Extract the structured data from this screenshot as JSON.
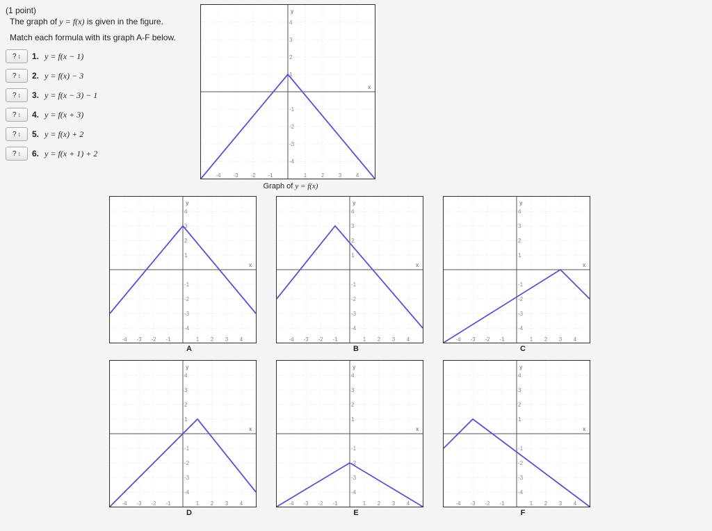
{
  "points_label": "(1 point)",
  "stem_pre": "The graph of ",
  "stem_eq": "y = f(x)",
  "stem_post": " is given in the figure.",
  "match_instr": "Match each formula with its graph A-F below.",
  "selector_placeholder": "?",
  "questions": [
    {
      "num": "1.",
      "text": "y = f(x − 1)"
    },
    {
      "num": "2.",
      "text": "y = f(x) − 3"
    },
    {
      "num": "3.",
      "text": "y = f(x − 3) − 1"
    },
    {
      "num": "4.",
      "text": "y = f(x + 3)"
    },
    {
      "num": "5.",
      "text": "y = f(x) + 2"
    },
    {
      "num": "6.",
      "text": "y = f(x + 1) + 2"
    }
  ],
  "main_caption_pre": "Graph of ",
  "main_caption_eq": "y = f(x)",
  "graph_labels": [
    "A",
    "B",
    "C",
    "D",
    "E",
    "F"
  ],
  "chart_data": [
    {
      "type": "line",
      "name": "main",
      "xlabel": "x",
      "ylabel": "y",
      "xlim": [
        -5,
        5
      ],
      "ylim": [
        -5,
        5
      ],
      "series": [
        {
          "name": "f(x)",
          "points": [
            [
              -5,
              -5
            ],
            [
              0,
              1
            ],
            [
              5,
              -5
            ]
          ]
        }
      ]
    },
    {
      "type": "line",
      "name": "A",
      "xlabel": "x",
      "ylabel": "y",
      "xlim": [
        -5,
        5
      ],
      "ylim": [
        -5,
        5
      ],
      "series": [
        {
          "name": "f(x)+2",
          "points": [
            [
              -5,
              -3
            ],
            [
              0,
              3
            ],
            [
              5,
              -3
            ]
          ]
        }
      ]
    },
    {
      "type": "line",
      "name": "B",
      "xlabel": "x",
      "ylabel": "y",
      "xlim": [
        -5,
        5
      ],
      "ylim": [
        -5,
        5
      ],
      "series": [
        {
          "name": "f(x+1)+2",
          "points": [
            [
              -5,
              -2
            ],
            [
              -1,
              3
            ],
            [
              5,
              -4
            ]
          ]
        }
      ]
    },
    {
      "type": "line",
      "name": "C",
      "xlabel": "x",
      "ylabel": "y",
      "xlim": [
        -5,
        5
      ],
      "ylim": [
        -5,
        5
      ],
      "series": [
        {
          "name": "f(x-3)-1",
          "points": [
            [
              -5,
              -5
            ],
            [
              3,
              0
            ],
            [
              5,
              -2
            ]
          ]
        }
      ]
    },
    {
      "type": "line",
      "name": "D",
      "xlabel": "x",
      "ylabel": "y",
      "xlim": [
        -5,
        5
      ],
      "ylim": [
        -5,
        5
      ],
      "series": [
        {
          "name": "f(x-1)",
          "points": [
            [
              -5,
              -5
            ],
            [
              1,
              1
            ],
            [
              5,
              -4
            ]
          ]
        }
      ]
    },
    {
      "type": "line",
      "name": "E",
      "xlabel": "x",
      "ylabel": "y",
      "xlim": [
        -5,
        5
      ],
      "ylim": [
        -5,
        5
      ],
      "series": [
        {
          "name": "f(x)-3",
          "points": [
            [
              -5,
              -5
            ],
            [
              0,
              -2
            ],
            [
              5,
              -5
            ]
          ]
        }
      ]
    },
    {
      "type": "line",
      "name": "F",
      "xlabel": "x",
      "ylabel": "y",
      "xlim": [
        -5,
        5
      ],
      "ylim": [
        -5,
        5
      ],
      "series": [
        {
          "name": "f(x+3)",
          "points": [
            [
              -5,
              -1
            ],
            [
              -3,
              1
            ],
            [
              5,
              -5
            ]
          ]
        }
      ]
    }
  ]
}
